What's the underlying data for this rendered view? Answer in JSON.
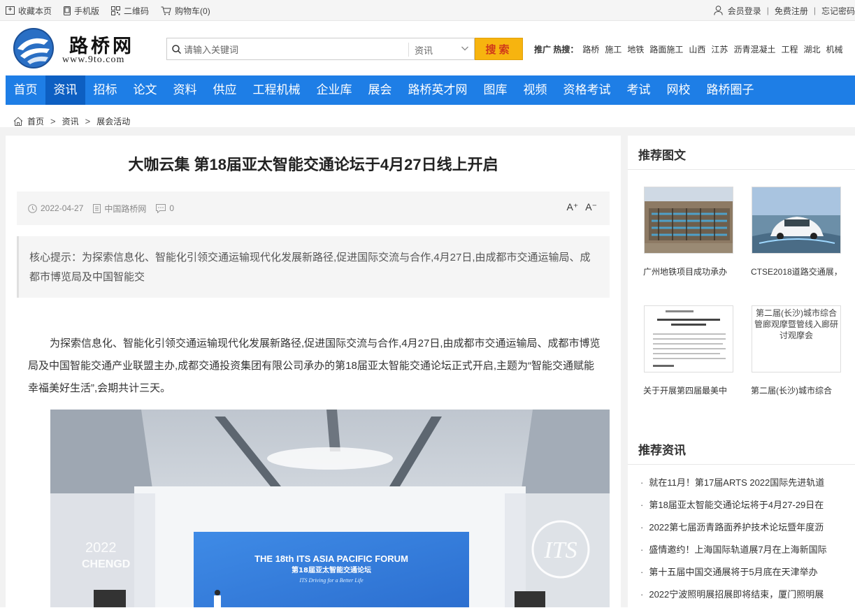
{
  "topbar": {
    "left": [
      "收藏本页",
      "手机版",
      "二维码",
      "购物车(0)"
    ],
    "right": [
      "会员登录",
      "免费注册",
      "忘记密码"
    ]
  },
  "logo": {
    "cn": "路桥网",
    "en": "www.9to.com"
  },
  "search": {
    "placeholder": "请输入关键词",
    "category": "资讯",
    "button": "搜索"
  },
  "hot": {
    "label": "推广 热搜：",
    "keywords": [
      "路桥",
      "施工",
      "地铁",
      "路面施工",
      "山西",
      "江苏",
      "沥青混凝土",
      "工程",
      "湖北",
      "机械"
    ]
  },
  "nav": [
    "首页",
    "资讯",
    "招标",
    "论文",
    "资料",
    "供应",
    "工程机械",
    "企业库",
    "展会",
    "路桥英才网",
    "图库",
    "视频",
    "资格考试",
    "考试",
    "网校",
    "路桥圈子"
  ],
  "breadcrumb": [
    "首页",
    "资讯",
    "展会活动"
  ],
  "article": {
    "title": "大咖云集 第18届亚太智能交通论坛于4月27日线上开启",
    "date": "2022-04-27",
    "source": "中国路桥网",
    "comments": "0",
    "font_up": "A⁺",
    "font_down": "A⁻",
    "summary": "核心提示：为探索信息化、智能化引领交通运输现代化发展新路径,促进国际交流与合作,4月27日,由成都市交通运输局、成都市博览局及中国智能交",
    "body": "为探索信息化、智能化引领交通运输现代化发展新路径,促进国际交流与合作,4月27日,由成都市交通运输局、成都市博览局及中国智能交通产业联盟主办,成都交通投资集团有限公司承办的第18届亚太智能交通论坛正式开启,主题为“智能交通赋能幸福美好生活”,会期共计三天。",
    "photo": {
      "banner_title": "THE 18th ITS ASIA PACIFIC FORUM",
      "banner_cn": "第18届亚太智能交通论坛",
      "banner_sub": "ITS Driving for a Better Life",
      "left_text_1": "2022",
      "left_text_2": "CHENGD",
      "right_text": "ITS"
    }
  },
  "sidebar": {
    "pics_title": "推荐图文",
    "pics": [
      {
        "caption": "广州地铁项目成功承办"
      },
      {
        "caption": "CTSE2018道路交通展，"
      },
      {
        "caption": "关于开展第四届最美中"
      },
      {
        "caption": "第二届(长沙)城市综合",
        "alt": "第二届(长沙)城市综合管廊观摩暨管线入廊研讨观摩会"
      }
    ],
    "news_title": "推荐资讯",
    "news": [
      "就在11月！第17届ARTS 2022国际先进轨道",
      "第18届亚太智能交通论坛将于4月27-29日在",
      "2022第七届沥青路面养护技术论坛暨年度沥",
      "盛情邀约！上海国际轨道展7月在上海新国际",
      "第十五届中国交通展将于5月底在天津举办",
      "2022宁波照明展招展即将结束，厦门照明展"
    ]
  },
  "colors": {
    "nav": "#1e7ee6",
    "nav_active": "#0d5fc2",
    "search_button": "#f7b40f"
  }
}
